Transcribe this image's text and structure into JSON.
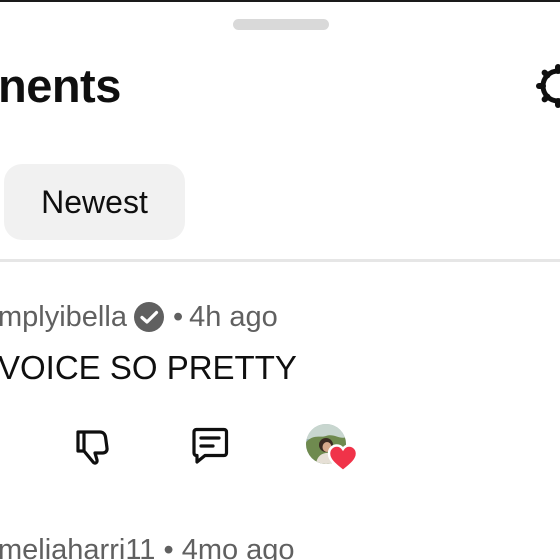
{
  "header": {
    "title": "nents",
    "settings_icon": "gear-icon"
  },
  "sort": {
    "selected_chip": "Newest"
  },
  "comments": [
    {
      "author": "mplyibella",
      "verified": true,
      "separator": "•",
      "time": "4h ago",
      "text": "VOICE SO PRETTY",
      "actions": [
        "thumbs-down-icon",
        "reply-icon",
        "creator-heart"
      ]
    },
    {
      "author": "meliaharri11",
      "separator": "•",
      "time": "4mo ago"
    }
  ],
  "colors": {
    "heart": "#f03349",
    "chip_bg": "#f1f1f1",
    "meta_text": "#606060",
    "primary_text": "#0f0f0f"
  }
}
